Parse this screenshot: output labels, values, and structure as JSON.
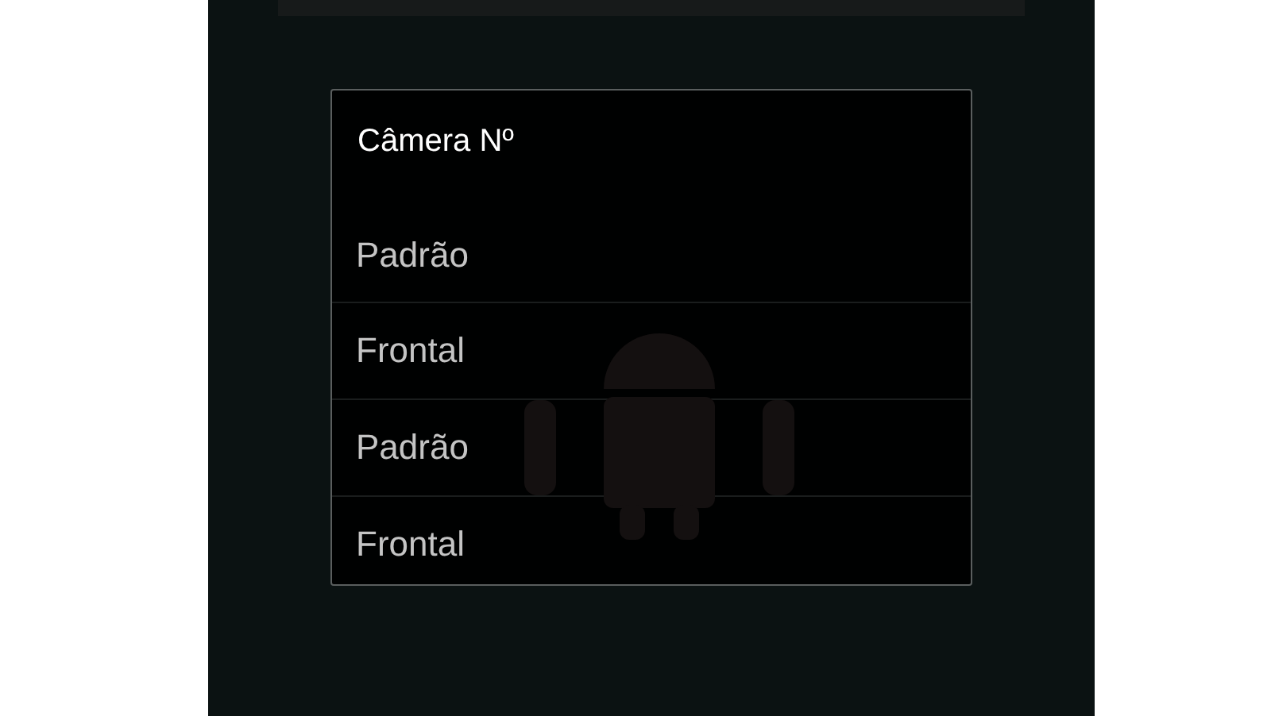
{
  "dialog": {
    "title": "Câmera Nº",
    "items": [
      {
        "label": "Padrão"
      },
      {
        "label": "Frontal"
      },
      {
        "label": "Padrão"
      },
      {
        "label": "Frontal"
      }
    ]
  }
}
